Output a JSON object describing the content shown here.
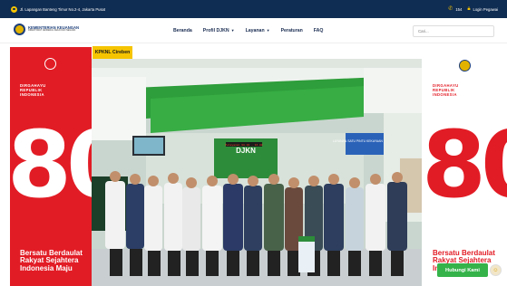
{
  "topbar": {
    "address": "Jl. Lapangan Banteng Timur No.2-4, Jakarta Pusat",
    "phone": "154",
    "login": "Login Pegawai"
  },
  "header": {
    "logo_line1": "KEMENTERIAN KEUANGAN",
    "logo_line2": "DIREKTORAT JENDERAL KEKAYAAN NEGARA"
  },
  "nav": {
    "items": [
      {
        "label": "Beranda",
        "dropdown": false
      },
      {
        "label": "Profil DJKN",
        "dropdown": true
      },
      {
        "label": "Layanan",
        "dropdown": true
      },
      {
        "label": "Peraturan",
        "dropdown": false
      },
      {
        "label": "FAQ",
        "dropdown": false
      }
    ],
    "search_placeholder": "Cari..."
  },
  "hero": {
    "badge": "KPKNL Cireben",
    "left_banner": {
      "dirgahayu": "DIRGAHAYU",
      "republik": "REPUBLIK",
      "indonesia": "INDONESIA",
      "number": "80",
      "slogan_line1": "Bersatu Berdaulat",
      "slogan_line2": "Rakyat Sejahtera",
      "slogan_line3": "Indonesia Maju"
    },
    "right_banner": {
      "dirgahayu": "DIRGAHAYU",
      "republik": "REPUBLIK",
      "indonesia": "INDONESIA",
      "number": "80",
      "slogan_line1": "Bersatu Berdaulat",
      "slogan_line2": "Rakyat Sejahtera",
      "slogan_line3": "In"
    },
    "photo_signs": {
      "center_sign": "Pelayanan 08.00 - 16.00",
      "right_sign": "LAYANAN SATU PINTU KEKAYAAN NEGARA",
      "wall_text": "DJKN"
    }
  },
  "chat": {
    "label": "Hubungi Kami"
  },
  "colors": {
    "topbar": "#0f2c52",
    "accent_yellow": "#f6c400",
    "banner_red": "#e21c25",
    "chat_green": "#35b34a",
    "office_green": "#2e9d3b"
  }
}
